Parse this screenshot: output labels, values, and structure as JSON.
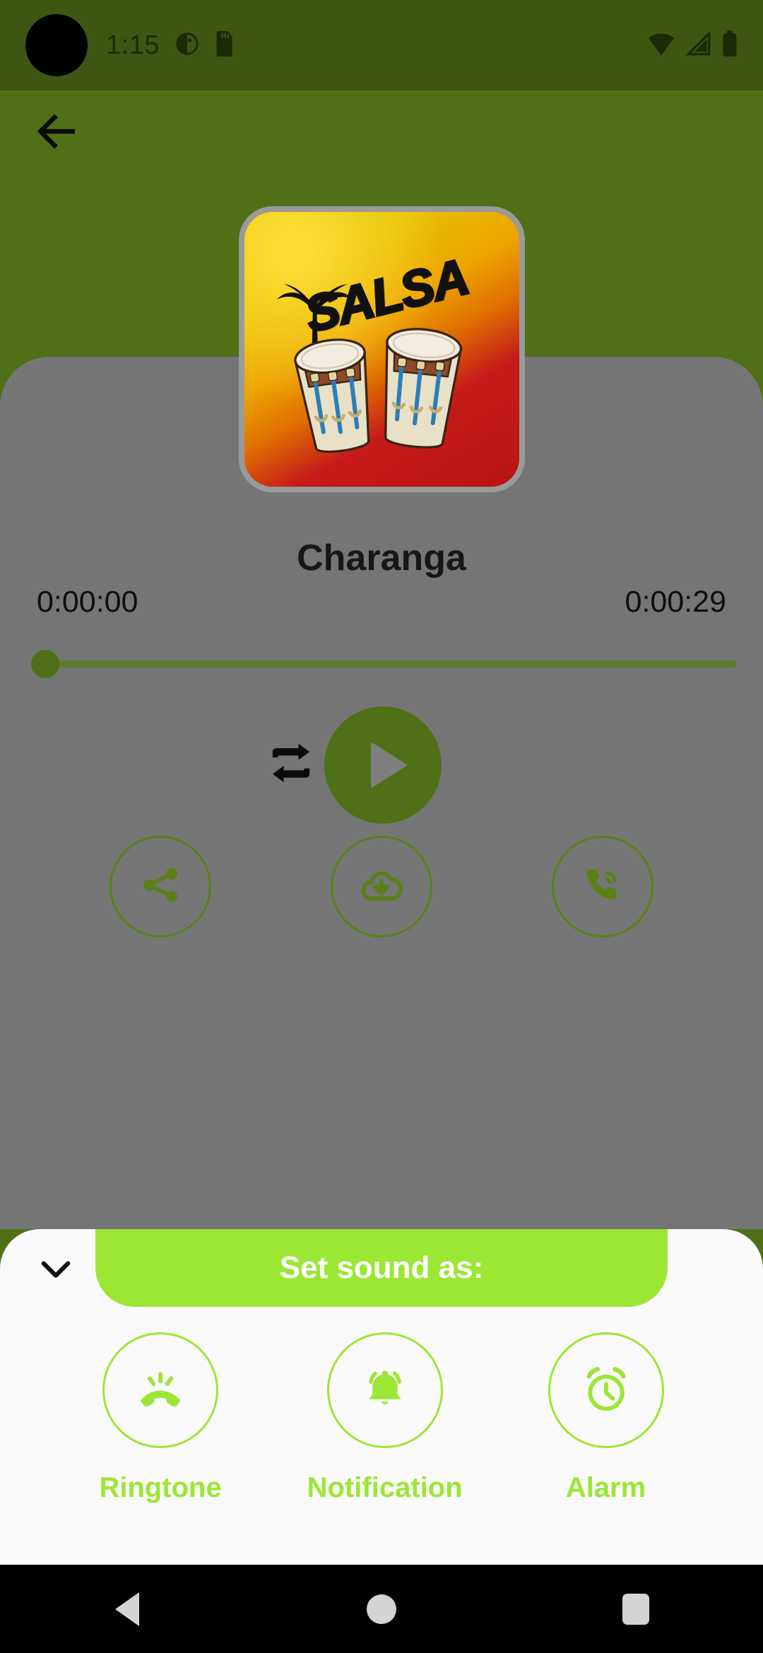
{
  "status_bar": {
    "clock": "1:15",
    "icons": [
      "camera-hole",
      "do-not-disturb-icon",
      "sd-card-icon",
      "wifi-icon",
      "signal-icon",
      "battery-icon"
    ],
    "background": "#3e5612"
  },
  "app_bar": {
    "back_icon": "back-arrow-icon"
  },
  "theme": {
    "background_green": "#4f7016",
    "card_grey": "#757575",
    "accent_green": "#5a8016",
    "lime": "#9ce634",
    "sheet_white": "#fafafa"
  },
  "player": {
    "album_art": {
      "icon": "salsa-album-art",
      "word": "SALSA"
    },
    "title": "Charanga",
    "elapsed": "0:00:00",
    "duration": "0:00:29",
    "progress_percent": 0,
    "repeat_icon": "repeat-icon",
    "play_icon": "play-icon",
    "actions": [
      {
        "name": "share",
        "icon": "share-icon"
      },
      {
        "name": "download",
        "icon": "cloud-download-icon"
      },
      {
        "name": "ringtone",
        "icon": "phone-ringing-icon"
      }
    ]
  },
  "bottom_sheet": {
    "collapse_icon": "chevron-down-icon",
    "banner_title": "Set sound as:",
    "options": [
      {
        "label": "Ringtone",
        "icon": "phone-ring-icon"
      },
      {
        "label": "Notification",
        "icon": "bell-icon"
      },
      {
        "label": "Alarm",
        "icon": "alarm-clock-icon"
      }
    ]
  },
  "nav_bar": {
    "buttons": [
      {
        "name": "back",
        "icon": "nav-back-icon"
      },
      {
        "name": "home",
        "icon": "nav-home-icon"
      },
      {
        "name": "recents",
        "icon": "nav-recents-icon"
      }
    ]
  }
}
